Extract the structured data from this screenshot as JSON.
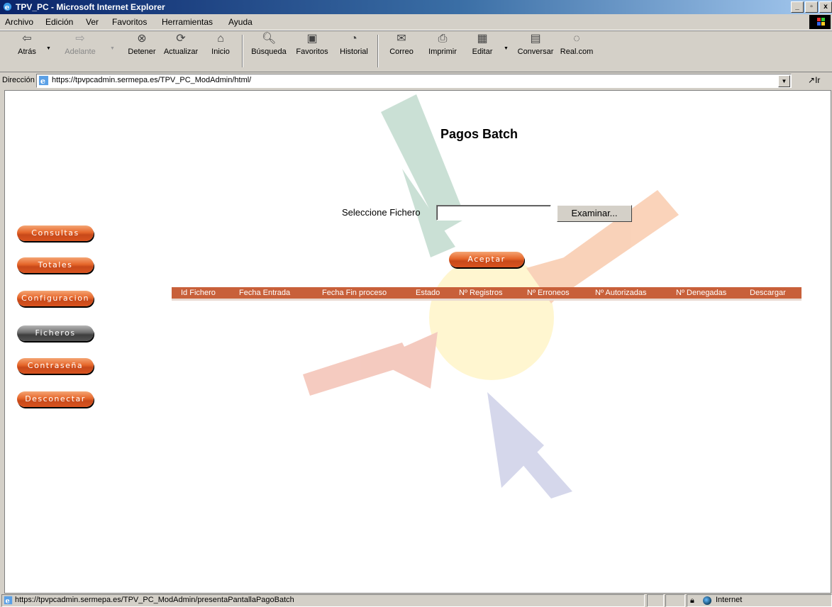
{
  "window": {
    "title": "TPV_PC - Microsoft Internet Explorer",
    "controls": [
      "_",
      "▫",
      "x"
    ]
  },
  "menu": [
    "Archivo",
    "Edición",
    "Ver",
    "Favoritos",
    "Herramientas",
    "Ayuda"
  ],
  "toolbar": {
    "back": "Atrás",
    "forward": "Adelante",
    "stop": "Detener",
    "refresh": "Actualizar",
    "home": "Inicio",
    "search": "Búsqueda",
    "favorites": "Favoritos",
    "history": "Historial",
    "mail": "Correo",
    "print": "Imprimir",
    "edit": "Editar",
    "discuss": "Conversar",
    "realcom": "Real.com"
  },
  "address": {
    "label": "Dirección",
    "url": "https://tpvpcadmin.sermepa.es/TPV_PC_ModAdmin/html/",
    "go": "Ir"
  },
  "page": {
    "title": "Pagos Batch",
    "file_label": "Seleccione Fichero",
    "file_value": "",
    "browse_label": "Examinar...",
    "accept_label": "Aceptar"
  },
  "sidebar": [
    {
      "label": "Consultas",
      "selected": false
    },
    {
      "label": "Totales",
      "selected": false
    },
    {
      "label": "Configuracion",
      "selected": false
    },
    {
      "label": "Ficheros",
      "selected": true
    },
    {
      "label": "Contraseña",
      "selected": false
    },
    {
      "label": "Desconectar",
      "selected": false
    }
  ],
  "table": {
    "columns": [
      "Id Fichero",
      "Fecha Entrada",
      "Fecha Fin proceso",
      "Estado",
      "Nº Registros",
      "Nº Erroneos",
      "Nº Autorizadas",
      "Nº Denegadas",
      "Descargar"
    ],
    "rows": []
  },
  "status": {
    "text": "https://tpvpcadmin.sermepa.es/TPV_PC_ModAdmin/presentaPantallaPagoBatch",
    "zone": "Internet"
  },
  "colors": {
    "accent_orange": "#c8603a",
    "selected_gray": "#555555",
    "titlebar": "#0a246a"
  }
}
